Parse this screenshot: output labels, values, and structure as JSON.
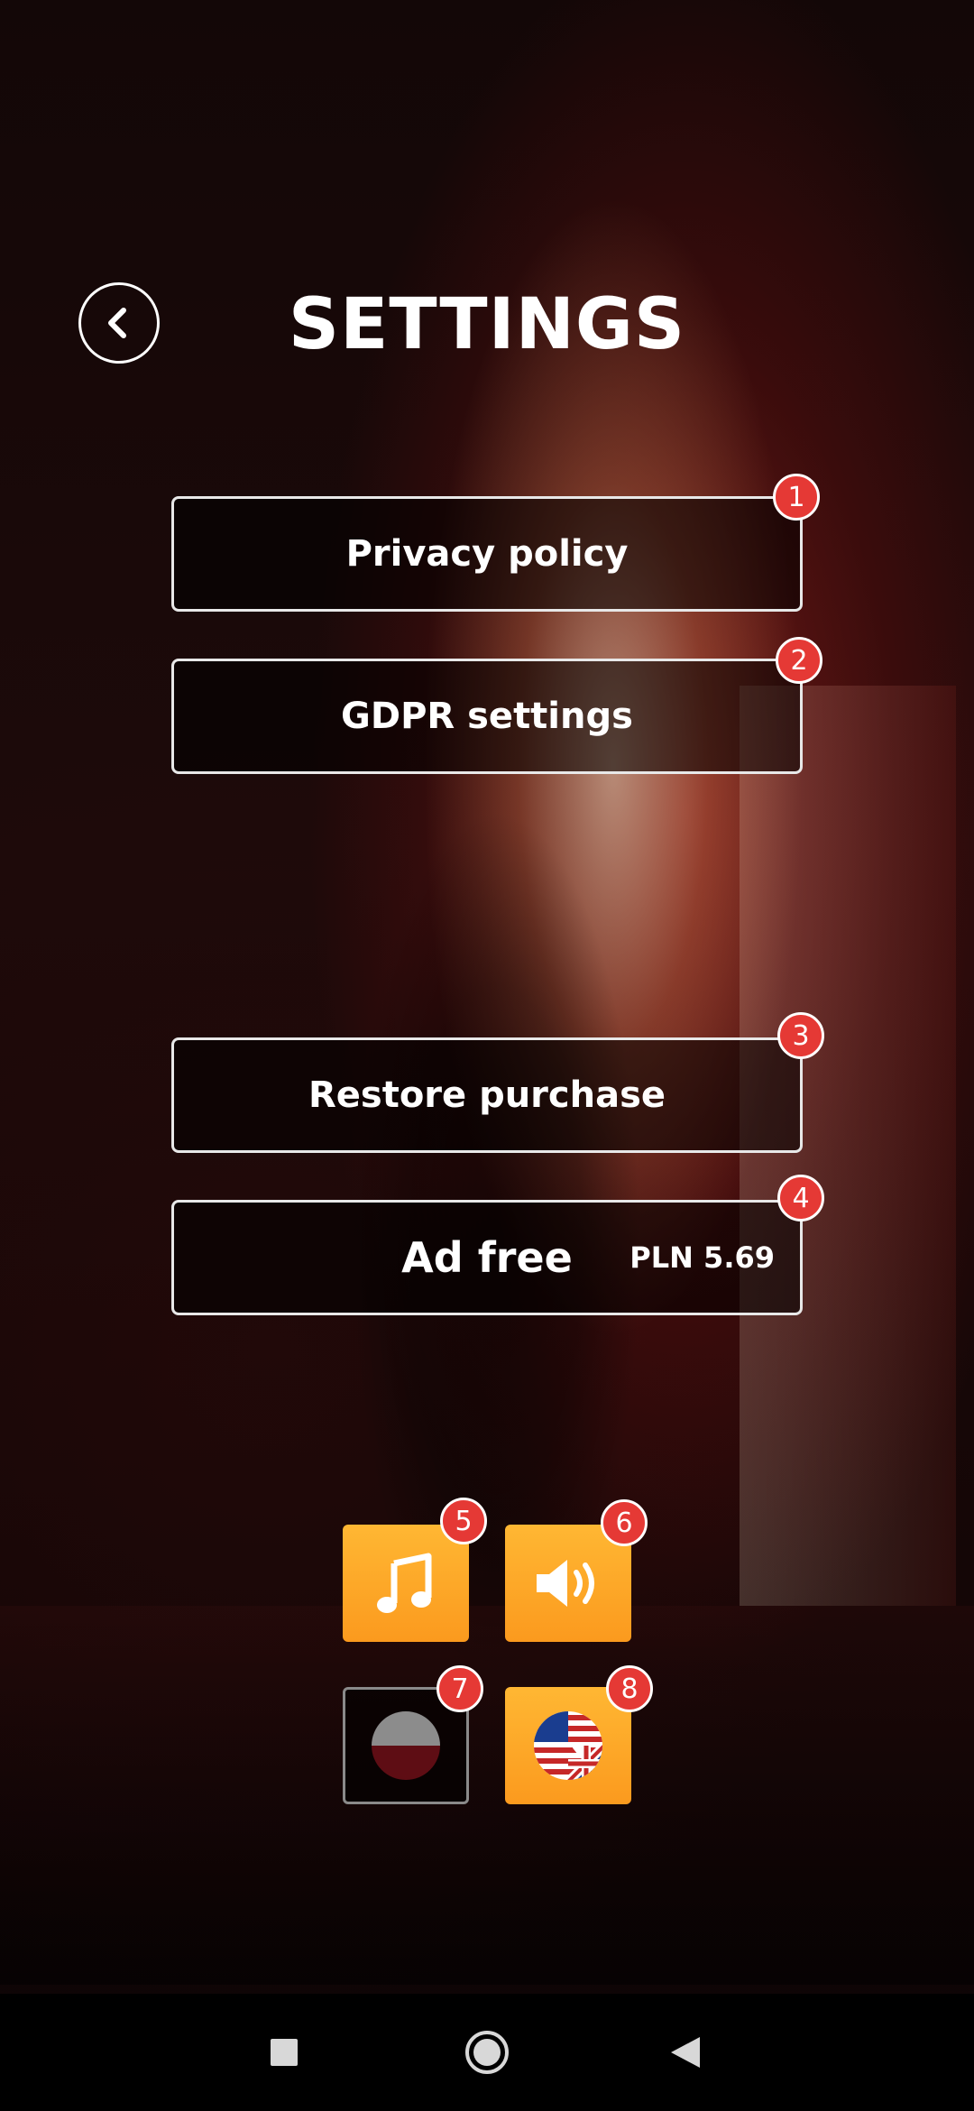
{
  "header": {
    "title": "SETTINGS",
    "back_icon": "chevron-left-icon"
  },
  "menu": {
    "items": [
      {
        "label": "Privacy policy",
        "badge": "1"
      },
      {
        "label": "GDPR settings",
        "badge": "2"
      },
      {
        "label": "Restore purchase",
        "badge": "3"
      },
      {
        "label": "Ad free",
        "price": "PLN 5.69",
        "badge": "4"
      }
    ]
  },
  "toggles": {
    "music": {
      "icon": "music-note-icon",
      "badge": "5",
      "state": "on"
    },
    "sound": {
      "icon": "speaker-icon",
      "badge": "6",
      "state": "on"
    },
    "language_polish": {
      "icon": "poland-flag-icon",
      "badge": "7",
      "state": "off"
    },
    "language_english": {
      "icon": "us-uk-flag-icon",
      "badge": "8",
      "state": "selected"
    }
  },
  "colors": {
    "accent_orange": "#fb9a1e",
    "badge_red": "#e53935",
    "button_border": "#e8e8e8"
  },
  "system_nav": {
    "icons": [
      "recent-apps-icon",
      "home-icon",
      "back-triangle-icon"
    ]
  }
}
